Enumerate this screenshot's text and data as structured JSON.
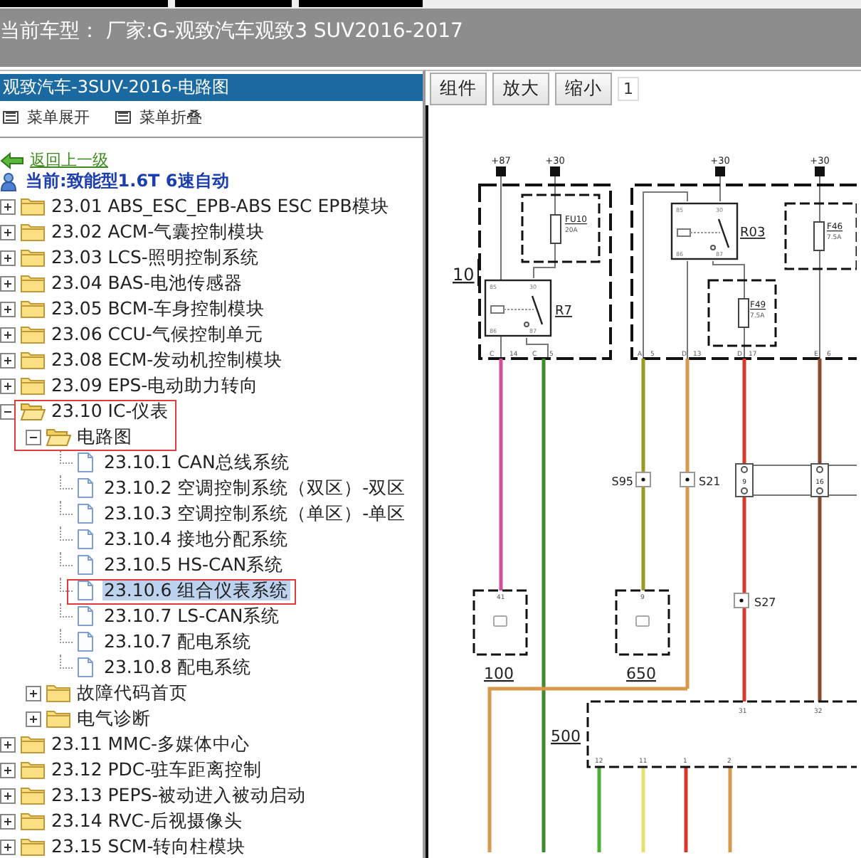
{
  "header": {
    "title": "当前车型： 厂家:G-观致汽车观致3 SUV2016-2017"
  },
  "sidebar": {
    "title": "观致汽车-3SUV-2016-电路图",
    "menu_actions": [
      "菜单展开",
      "菜单折叠"
    ],
    "back_link": "返回上一级",
    "current": "当前:致能型1.6T 6速自动",
    "tree": [
      {
        "label": "23.01 ABS_ESC_EPB-ABS ESC EPB模块",
        "kind": "folder",
        "expanded": false,
        "selected": false,
        "outlined": false
      },
      {
        "label": "23.02 ACM-气囊控制模块",
        "kind": "folder",
        "expanded": false,
        "selected": false,
        "outlined": false
      },
      {
        "label": "23.03 LCS-照明控制系统",
        "kind": "folder",
        "expanded": false,
        "selected": false,
        "outlined": false
      },
      {
        "label": "23.04 BAS-电池传感器",
        "kind": "folder",
        "expanded": false,
        "selected": false,
        "outlined": false
      },
      {
        "label": "23.05 BCM-车身控制模块",
        "kind": "folder",
        "expanded": false,
        "selected": false,
        "outlined": false
      },
      {
        "label": "23.06 CCU-气候控制单元",
        "kind": "folder",
        "expanded": false,
        "selected": false,
        "outlined": false
      },
      {
        "label": "23.08 ECM-发动机控制模块",
        "kind": "folder",
        "expanded": false,
        "selected": false,
        "outlined": false
      },
      {
        "label": "23.09 EPS-电动助力转向",
        "kind": "folder",
        "expanded": false,
        "selected": false,
        "outlined": false
      },
      {
        "label": "23.10 IC-仪表",
        "kind": "folder",
        "expanded": true,
        "selected": false,
        "outlined": true,
        "children": [
          {
            "label": "电路图",
            "kind": "folder",
            "expanded": true,
            "selected": false,
            "outlined": true,
            "children": [
              {
                "label": "23.10.1 CAN总线系统",
                "kind": "doc",
                "selected": false,
                "outlined": false
              },
              {
                "label": "23.10.2 空调控制系统（双区）-双区",
                "kind": "doc",
                "selected": false,
                "outlined": false
              },
              {
                "label": "23.10.3 空调控制系统（单区）-单区",
                "kind": "doc",
                "selected": false,
                "outlined": false
              },
              {
                "label": "23.10.4 接地分配系统",
                "kind": "doc",
                "selected": false,
                "outlined": false
              },
              {
                "label": "23.10.5 HS-CAN系统",
                "kind": "doc",
                "selected": false,
                "outlined": false
              },
              {
                "label": "23.10.6 组合仪表系统",
                "kind": "doc",
                "selected": true,
                "outlined": true
              },
              {
                "label": "23.10.7 LS-CAN系统",
                "kind": "doc",
                "selected": false,
                "outlined": false
              },
              {
                "label": "23.10.7 配电系统",
                "kind": "doc",
                "selected": false,
                "outlined": false
              },
              {
                "label": "23.10.8 配电系统",
                "kind": "doc",
                "selected": false,
                "outlined": false
              }
            ]
          },
          {
            "label": "故障代码首页",
            "kind": "folder",
            "expanded": false,
            "selected": false,
            "outlined": false
          },
          {
            "label": "电气诊断",
            "kind": "folder",
            "expanded": false,
            "selected": false,
            "outlined": false
          }
        ]
      },
      {
        "label": "23.11 MMC-多媒体中心",
        "kind": "folder",
        "expanded": false,
        "selected": false,
        "outlined": false
      },
      {
        "label": "23.12 PDC-驻车距离控制",
        "kind": "folder",
        "expanded": false,
        "selected": false,
        "outlined": false
      },
      {
        "label": "23.13 PEPS-被动进入被动启动",
        "kind": "folder",
        "expanded": false,
        "selected": false,
        "outlined": false
      },
      {
        "label": "23.14 RVC-后视摄像头",
        "kind": "folder",
        "expanded": false,
        "selected": false,
        "outlined": false
      },
      {
        "label": "23.15 SCM-转向柱模块",
        "kind": "folder",
        "expanded": false,
        "selected": false,
        "outlined": false
      }
    ]
  },
  "viewer": {
    "toolbar": {
      "buttons": [
        "组件",
        "放大",
        "缩小"
      ],
      "page": "1"
    },
    "diagram": {
      "terminals": [
        "+87",
        "+30",
        "+30",
        "+30"
      ],
      "module_numbers": [
        "10",
        "100",
        "650",
        "500"
      ],
      "relays": [
        {
          "name": "R7",
          "pins": [
            "85",
            "30",
            "86",
            "87"
          ]
        },
        {
          "name": "R03",
          "pins": [
            "85",
            "30",
            "86",
            "87"
          ]
        }
      ],
      "fuses": [
        {
          "name": "FU10",
          "rating": "20A"
        },
        {
          "name": "F46",
          "rating": "7.5A"
        },
        {
          "name": "F49",
          "rating": "7.5A"
        }
      ],
      "splices": [
        "S95",
        "S21",
        "S27"
      ],
      "connectors": [
        "9",
        "16"
      ],
      "pin_letters": [
        "C",
        "C",
        "A",
        "D",
        "D",
        "E"
      ],
      "pins": [
        "14",
        "5",
        "5",
        "13",
        "17",
        "6",
        "41",
        "9",
        "31",
        "32",
        "12",
        "11",
        "1",
        "2"
      ],
      "wires": [
        {
          "color": "#d0509c"
        },
        {
          "color": "#3f8a2e"
        },
        {
          "color": "#9a9a1e"
        },
        {
          "color": "#d89a4a"
        },
        {
          "color": "#d8372e"
        },
        {
          "color": "#8a4a2a"
        },
        {
          "color": "#d89a4a"
        },
        {
          "color": "#4caf3a"
        },
        {
          "color": "#e8e070"
        },
        {
          "color": "#d8372e"
        },
        {
          "color": "#d89a4a"
        }
      ]
    }
  }
}
